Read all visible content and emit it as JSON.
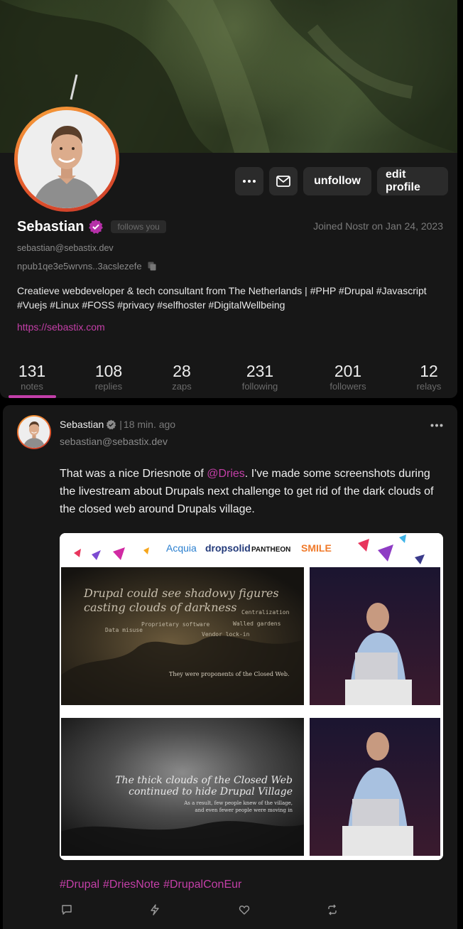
{
  "profile": {
    "name": "Sebastian",
    "follows_badge": "follows you",
    "joined": "Joined Nostr on Jan 24, 2023",
    "nip05": "sebastian@sebastix.dev",
    "npub": "npub1qe3e5wrvns..3acslezefe",
    "bio": "Creatieve webdeveloper & tech consultant from The Netherlands | #PHP #Drupal #Javascript #Vuejs #Linux #FOSS #privacy #selfhoster #DigitalWellbeing",
    "website": "https://sebastix.com",
    "accent_color": "#c23fa9",
    "avatar_ring_color": "#e8612c"
  },
  "actions": {
    "more_icon": "ellipsis-icon",
    "message_icon": "envelope-icon",
    "unfollow_label": "unfollow",
    "edit_label": "edit profile"
  },
  "stats": [
    {
      "value": "131",
      "label": "notes"
    },
    {
      "value": "108",
      "label": "replies"
    },
    {
      "value": "28",
      "label": "zaps"
    },
    {
      "value": "231",
      "label": "following"
    },
    {
      "value": "201",
      "label": "followers"
    },
    {
      "value": "12",
      "label": "relays"
    }
  ],
  "note": {
    "author": "Sebastian",
    "separator": "|",
    "time": "18 min. ago",
    "nip05": "sebastian@sebastix.dev",
    "text_before": "That was a nice Driesnote of ",
    "mention": "@Dries",
    "text_after": ". I've made some screenshots during the livestream about Drupals next challenge to get rid of the dark clouds of the closed web around Drupals village.",
    "media": {
      "sponsors": [
        "Acquia",
        "dropsolid",
        "PANTHEON",
        "SMILE"
      ],
      "slide1_title_line1": "Drupal could see shadowy figures",
      "slide1_title_line2": "casting clouds of darkness",
      "slide1_words": [
        "Centralization",
        "Proprietary software",
        "Walled gardens",
        "Data misuse",
        "Vendor lock-in"
      ],
      "slide1_caption": "They were proponents of the Closed Web.",
      "slide2_title_line1": "The thick clouds of the Closed Web",
      "slide2_title_line2": "continued to hide Drupal Village",
      "slide2_caption_line1": "As a result, few people knew of the village,",
      "slide2_caption_line2": "and even fewer people were moving in"
    },
    "hashtags": [
      "#Drupal",
      "#DriesNote",
      "#DrupalConEur"
    ],
    "actions": [
      "reply-icon",
      "zap-icon",
      "like-icon",
      "repost-icon"
    ]
  }
}
